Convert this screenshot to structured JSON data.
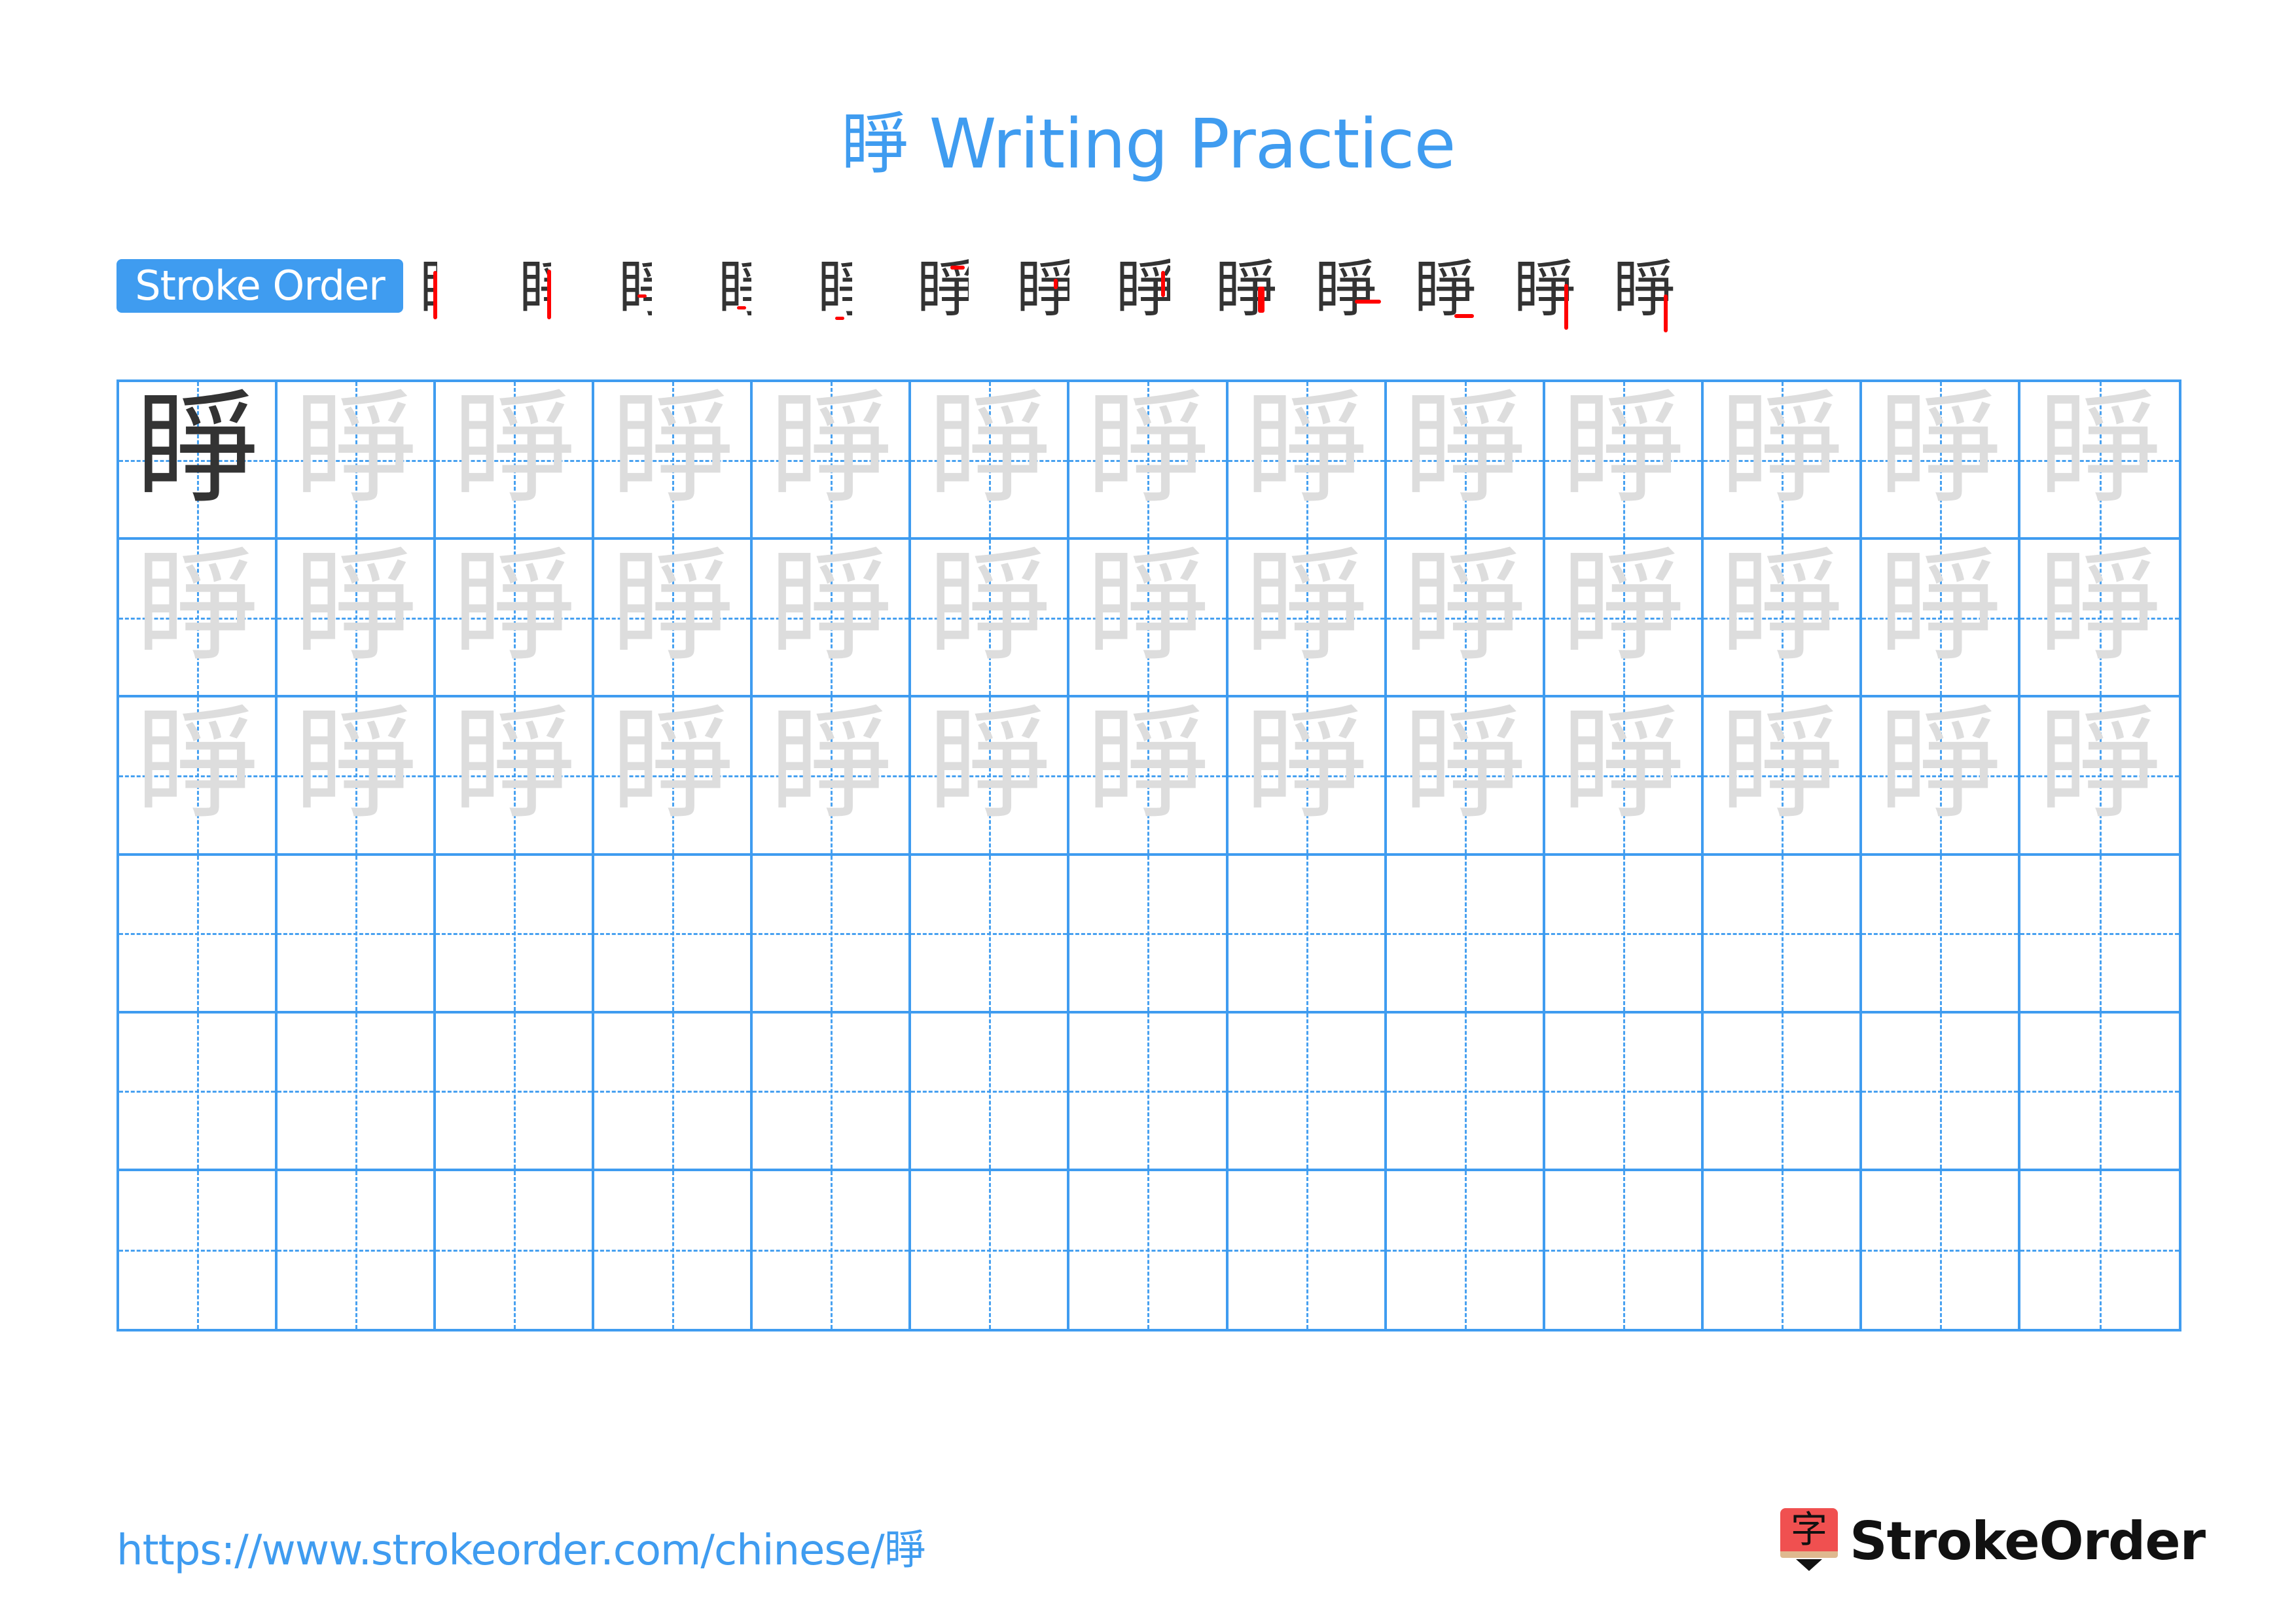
{
  "character": "睜",
  "title": {
    "char": "睜",
    "text": " Writing Practice"
  },
  "stroke_order": {
    "label": "Stroke Order",
    "total_strokes": 13,
    "new_stroke_color": "#ff0000",
    "done_stroke_color": "#333333"
  },
  "grid": {
    "rows": 6,
    "columns": 13,
    "line_color": "#3f9cf0",
    "model_color": "#333333",
    "trace_color": "#dddddd",
    "traced_rows": 3
  },
  "footer": {
    "url": "https://www.strokeorder.com/chinese/睜",
    "logo_char": "字",
    "logo_text": "StrokeOrder"
  }
}
